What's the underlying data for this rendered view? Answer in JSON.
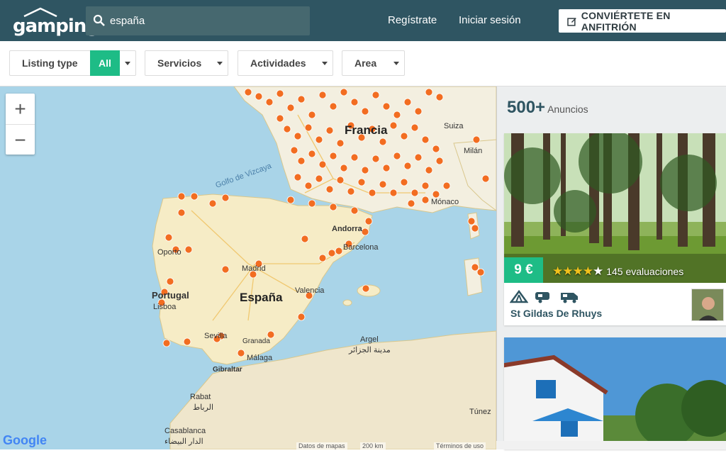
{
  "brand": {
    "logo": "gamping",
    "colors": {
      "header": "#2f5562",
      "accent": "#1ebc86",
      "pin": "#f26d21"
    }
  },
  "search": {
    "value": "españa",
    "icon": "search-icon"
  },
  "nav": {
    "register": "Regístrate",
    "login": "Iniciar sesión",
    "host": "CONVIÉRTETE EN ANFITRIÓN",
    "host_icon": "edit-icon"
  },
  "filters": {
    "listing_type": "Listing type",
    "all": "All",
    "services": "Servicios",
    "activities": "Actividades",
    "area": "Area"
  },
  "map": {
    "zoom_in": "+",
    "zoom_out": "−",
    "labels": {
      "france": "Francia",
      "suiza": "Suiza",
      "milan": "Milán",
      "golfo": "Golfo de Vizcaya",
      "monaco": "Mónaco",
      "andorra": "Andorra",
      "barcelona": "Barcelona",
      "oporto": "Oporto",
      "madrid": "Madrid",
      "espana": "España",
      "portugal": "Portugal",
      "lisboa": "Lisboa",
      "valencia": "Valencia",
      "sevilla": "Sevilla",
      "granada": "Granada",
      "malaga": "Málaga",
      "gibraltar": "Gibraltar",
      "argel": "Argel",
      "argel_ar": "مدينة الجزائر",
      "tunez": "Túnez",
      "rabat": "Rabat",
      "rabat_ar": "الرباط",
      "casablanca": "Casablanca",
      "casablanca_ar": "الدار البيضاء"
    },
    "google": "Google",
    "attribution": {
      "data": "Datos de mapas",
      "scale": "200 km",
      "terms": "Términos de uso"
    }
  },
  "results": {
    "count": "500+",
    "count_label": "Anuncios",
    "listings": [
      {
        "price": "9 €",
        "rating": 4,
        "reviews": "145 evaluaciones",
        "place": "St Gildas De Rhuys",
        "amenities": [
          "tent-icon",
          "caravan-icon",
          "camper-icon"
        ]
      }
    ]
  }
}
